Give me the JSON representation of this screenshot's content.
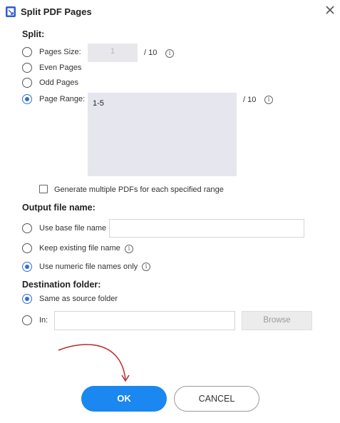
{
  "dialog": {
    "title": "Split PDF Pages",
    "close_icon": "close-icon"
  },
  "split": {
    "heading": "Split:",
    "pages_size_label": "Pages Size:",
    "pages_size_value": "1",
    "pages_size_total": "/ 10",
    "even_pages_label": "Even Pages",
    "odd_pages_label": "Odd Pages",
    "page_range_label": "Page Range:",
    "page_range_value": "1-5",
    "page_range_total": "/ 10",
    "selected": "page_range"
  },
  "generate_multiple_label": "Generate multiple PDFs for each specified range",
  "output": {
    "heading": "Output file name:",
    "use_base_label": "Use base file name",
    "use_base_value": "",
    "keep_existing_label": "Keep existing file name",
    "numeric_label": "Use numeric file names only",
    "selected": "numeric"
  },
  "destination": {
    "heading": "Destination folder:",
    "same_as_source_label": "Same as source folder",
    "in_label": "In:",
    "in_value": "",
    "browse_label": "Browse",
    "selected": "same_as_source"
  },
  "buttons": {
    "ok_label": "OK",
    "cancel_label": "CANCEL"
  },
  "colors": {
    "accent": "#1b87f0",
    "radio_selected": "#2f6fd6",
    "annotation_arrow": "#c0282d"
  }
}
